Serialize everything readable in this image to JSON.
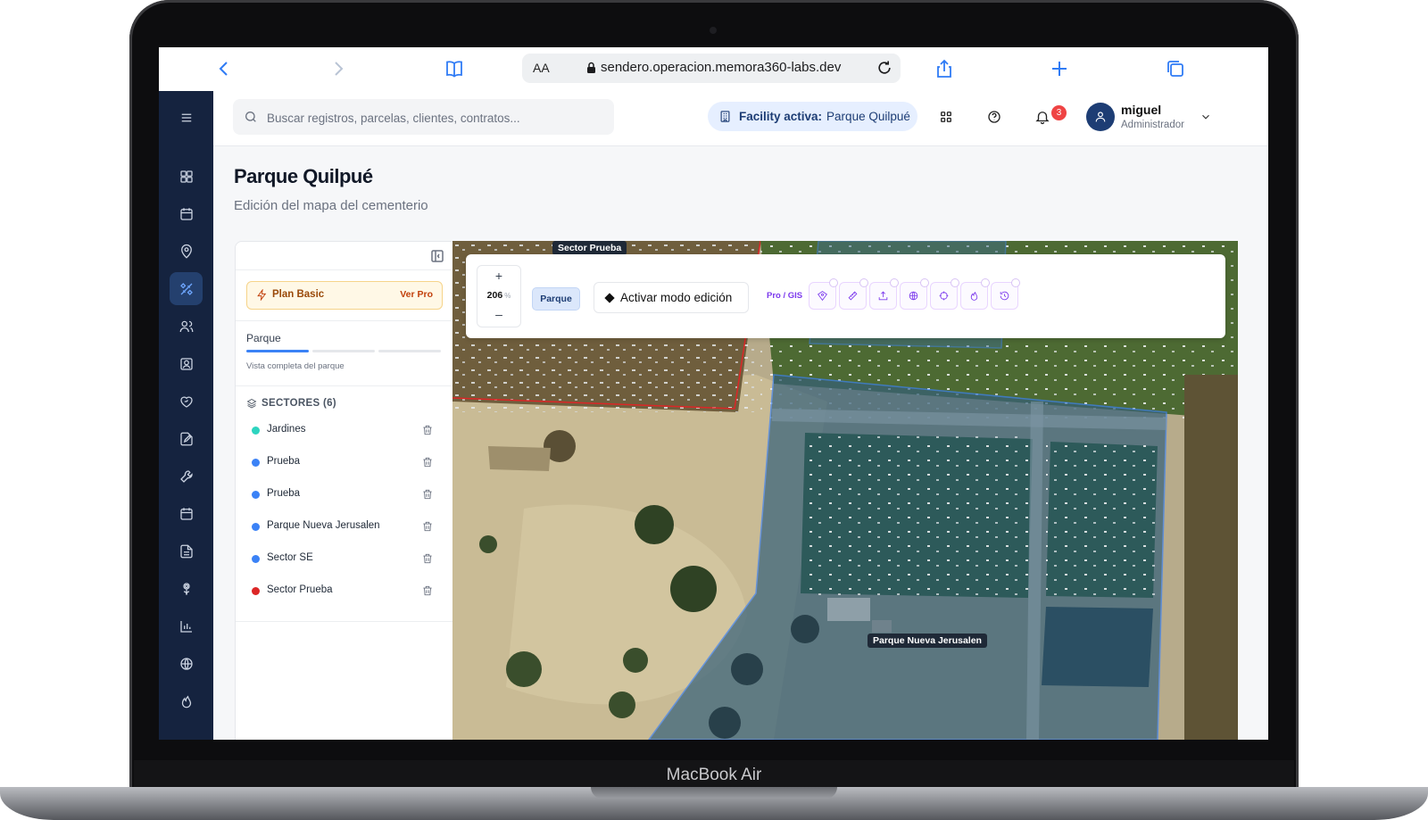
{
  "device": {
    "label": "MacBook Air"
  },
  "browser": {
    "text_size": "AA",
    "url": "sendero.operacion.memora360-labs.dev"
  },
  "topbar": {
    "search_placeholder": "Buscar registros, parcelas, clientes, contratos...",
    "facility_label": "Facility activa:",
    "facility_value": "Parque Quilpué",
    "notifications_count": "3",
    "user_name": "miguel",
    "user_role": "Administrador"
  },
  "page": {
    "title": "Parque Quilpué",
    "subtitle": "Edición del mapa del cementerio"
  },
  "panel": {
    "plan_label": "Plan Basic",
    "plan_cta": "Ver Pro",
    "level_title": "Parque",
    "level_progress_step": 1,
    "level_progress_total": 3,
    "level_subtitle": "Vista completa del parque",
    "sectors_header": "SECTORES (6)",
    "sectors": [
      {
        "name": "Jardines",
        "color": "#2dd4bf"
      },
      {
        "name": "Prueba",
        "color": "#3b82f6"
      },
      {
        "name": "Prueba",
        "color": "#3b82f6"
      },
      {
        "name": "Parque Nueva Jerusalen",
        "color": "#3b82f6"
      },
      {
        "name": "Sector SE",
        "color": "#3b82f6"
      },
      {
        "name": "Sector Prueba",
        "color": "#dc2626"
      }
    ]
  },
  "map": {
    "zoom_in": "+",
    "zoom_value": "206",
    "zoom_unit": "%",
    "zoom_out": "–",
    "level_tag": "Parque",
    "edit_button": "Activar modo edición",
    "pro_label": "Pro / GIS",
    "pro_tools": [
      "geofence-icon",
      "ruler-icon",
      "upload-icon",
      "globe-icon",
      "crosshair-icon",
      "flame-icon",
      "history-icon"
    ],
    "labels": {
      "sector_prueba": "Sector Prueba",
      "parque_nueva_jerusalen": "Parque Nueva Jerusalen"
    }
  },
  "colors": {
    "sidebar": "#15233f",
    "accent": "#3b82f6",
    "pro": "#7c3aed",
    "sector_red": "#dc2626"
  }
}
